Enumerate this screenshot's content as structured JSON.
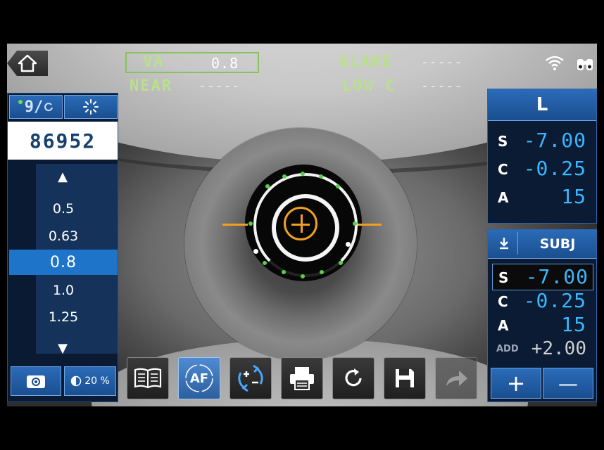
{
  "top": {
    "va_label": "VA",
    "va_value": "0.8",
    "near_label": "NEAR",
    "near_value": "-----",
    "glare_label": "GLARE",
    "glare_value": "-----",
    "lowc_label": "LOW C",
    "lowc_value": "-----",
    "icons": [
      "home-icon",
      "wifi-icon",
      "binoculars-icon"
    ]
  },
  "left": {
    "mode_label": "9/",
    "counter": "86952",
    "va_list": [
      "0.5",
      "0.63",
      "0.8",
      "1.0",
      "1.25"
    ],
    "selected_va": "0.8",
    "brightness": "20 %"
  },
  "right_l": {
    "header": "L",
    "rows": [
      {
        "label": "S",
        "value": "-7.00"
      },
      {
        "label": "C",
        "value": "-0.25"
      },
      {
        "label": "A",
        "value": "15"
      }
    ]
  },
  "right_subj": {
    "header": "SUBJ",
    "rows": [
      {
        "label": "S",
        "value": "-7.00"
      },
      {
        "label": "C",
        "value": "-0.25"
      },
      {
        "label": "A",
        "value": "15"
      }
    ],
    "add_label": "ADD",
    "add_value": "+2.00",
    "plus": "+",
    "minus": "—"
  },
  "toolbar": {
    "af_label": "AF",
    "icons": [
      "book-icon",
      "af-icon",
      "plus-minus-cycle-icon",
      "print-icon",
      "refresh-icon",
      "save-icon",
      "forward-arrow-icon"
    ]
  },
  "colors": {
    "accent_blue": "#1e74c8",
    "value_blue": "#39b7ff",
    "label_green": "#b9e08a",
    "target_orange": "#f0a020"
  }
}
